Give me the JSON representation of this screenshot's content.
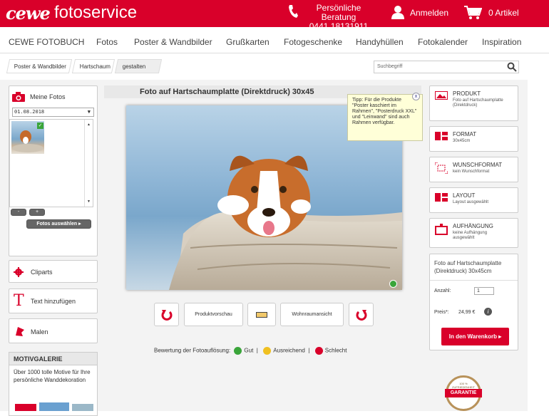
{
  "header": {
    "logo": "cewe",
    "logo_suffix": "fotoservice",
    "phone_text": "Persönliche Beratung",
    "phone_number": "0441 18131911",
    "login": "Anmelden",
    "cart": "0 Artikel"
  },
  "nav": [
    "CEWE FOTOBUCH",
    "Fotos",
    "Poster & Wandbilder",
    "Grußkarten",
    "Fotogeschenke",
    "Handyhüllen",
    "Fotokalender",
    "Inspiration"
  ],
  "breadcrumb": [
    "Poster & Wandbilder",
    "Hartschaum",
    "gestalten"
  ],
  "search": {
    "placeholder": "Suchbegriff"
  },
  "left": {
    "my_photos": "Meine Fotos",
    "date": "01.08.2018",
    "minus": "-",
    "plus": "+",
    "select_photos": "Fotos auswählen",
    "cliparts": "Cliparts",
    "add_text": "Text hinzufügen",
    "paint": "Malen",
    "gallery_title": "MOTIVGALERIE",
    "gallery_text": "Über 1000 tolle Motive für Ihre persönliche Wanddekoration"
  },
  "center": {
    "title": "Foto auf Hartschaumplatte (Direktdruck) 30x45",
    "preview": "Produktvorschau",
    "room": "Wohnraumansicht",
    "rating_label": "Bewertung der Fotoauflösung:",
    "good": "Gut",
    "ok": "Ausreichend",
    "bad": "Schlecht"
  },
  "tip": {
    "text": "Tipp: Für die Produkte \"Poster kaschiert im Rahmen\", \"Posterdruck XXL\" und \"Leinwand\" sind auch Rahmen verfügbar.",
    "close": "x"
  },
  "right": {
    "product_t": "PRODUKT",
    "product_s": "Foto auf Hartschaumplatte (Direktdruck)",
    "format_t": "FORMAT",
    "format_s": "30x45cm",
    "wish_t": "WUNSCHFORMAT",
    "wish_s": "kein Wunschformat",
    "layout_t": "LAYOUT",
    "layout_s": "Layout ausgewählt",
    "hang_t": "AUFHÄNGUNG",
    "hang_s": "keine Aufhängung ausgewählt",
    "summary": "Foto auf Hartschaumplatte (Direktdruck) 30x45cm",
    "qty_label": "Anzahl:",
    "qty": "1",
    "price_label": "Preis*:",
    "price": "24,99 €",
    "add_to_cart": "In den Warenkorb",
    "badge_top": "100 % ZUFRIEDENHEIT",
    "badge": "GARANTIE"
  },
  "colors": {
    "brand": "#d9002a",
    "good": "#3aa53a",
    "ok": "#f0c020",
    "bad": "#d9002a"
  }
}
